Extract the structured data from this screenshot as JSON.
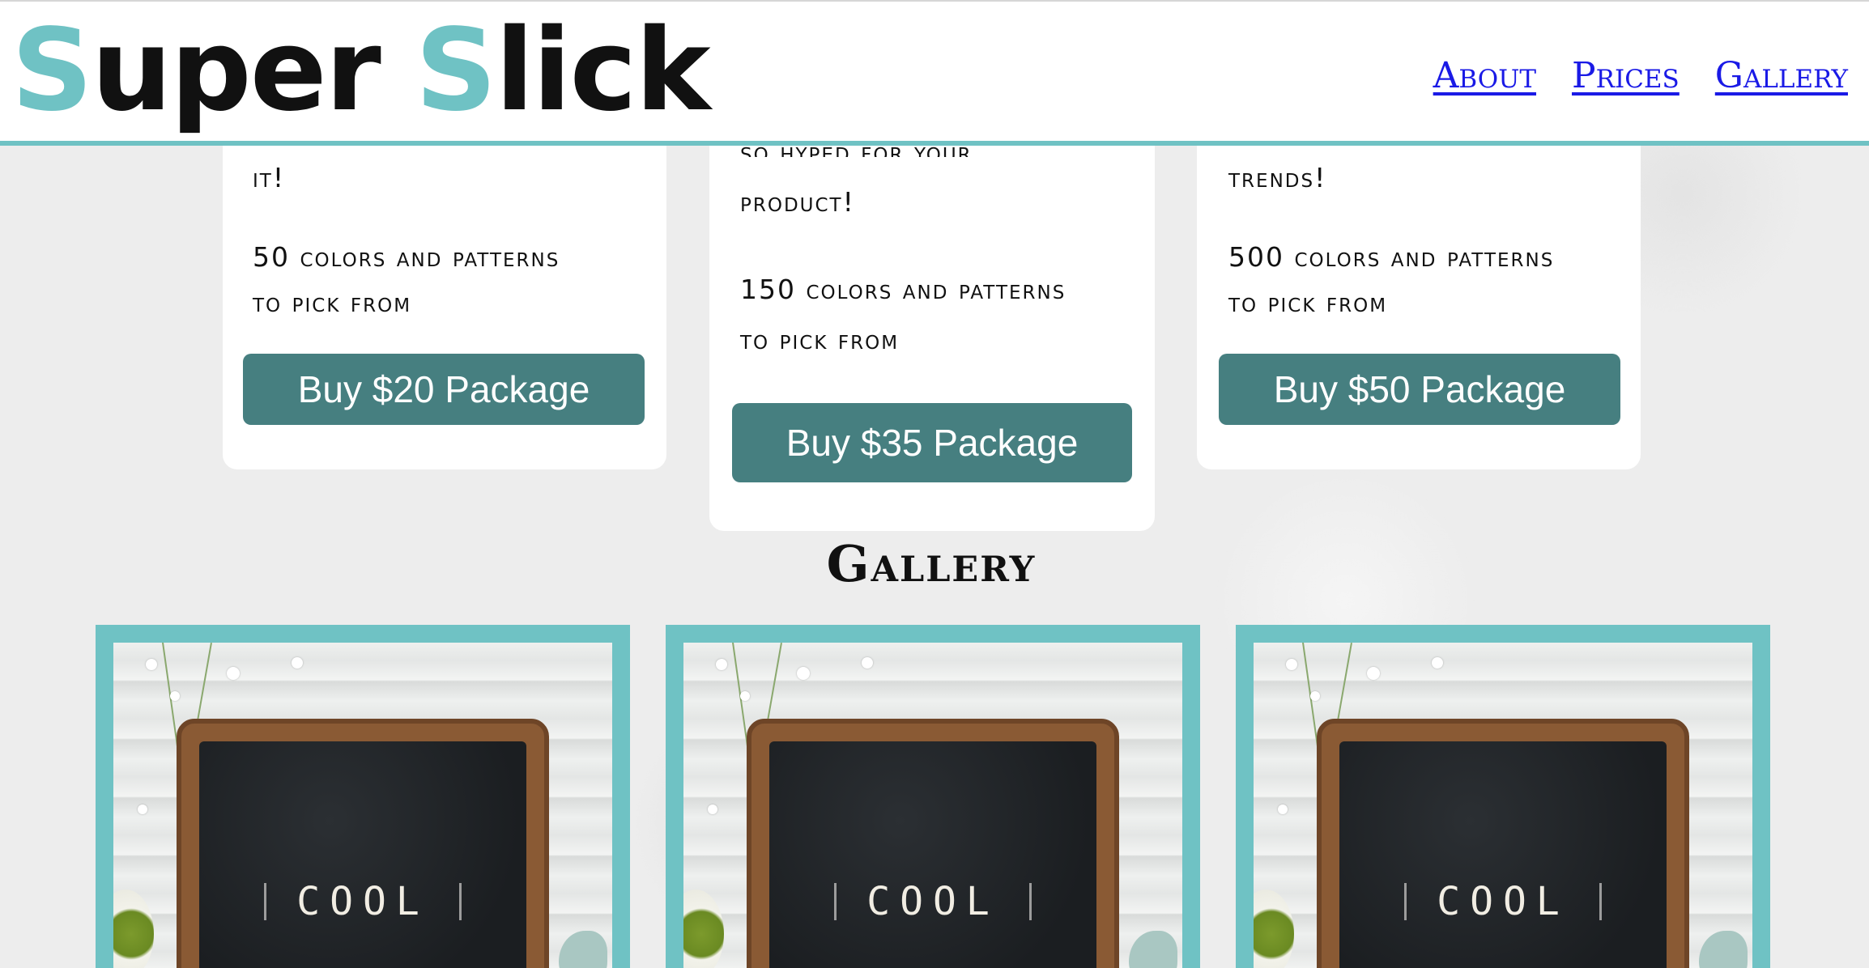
{
  "header": {
    "logo": {
      "first_initial": "S",
      "first_rest": "uper",
      "second_initial": "S",
      "second_rest": "lick"
    },
    "nav": [
      {
        "label": "About"
      },
      {
        "label": "Prices"
      },
      {
        "label": "Gallery"
      }
    ]
  },
  "pricing": {
    "cards": [
      {
        "top_text": "it!",
        "colors_line1": "50 colors and patterns",
        "colors_line2": "to pick from",
        "button_label": "Buy $20 Package"
      },
      {
        "top_text_line1": "so hyped for your",
        "top_text_line2": "product!",
        "colors_line1": "150 colors and patterns",
        "colors_line2": "to pick from",
        "button_label": "Buy $35 Package"
      },
      {
        "top_text": "trends!",
        "colors_line1": "500 colors and patterns",
        "colors_line2": "to pick from",
        "button_label": "Buy $50 Package"
      }
    ]
  },
  "gallery": {
    "title": "Gallery",
    "images": [
      {
        "board_text": "COOL"
      },
      {
        "board_text": "COOL"
      },
      {
        "board_text": "COOL"
      }
    ]
  },
  "colors": {
    "accent": "#6fc2c4",
    "button": "#467f80",
    "nav_link": "#1a1ae6",
    "card_background": "#ffffff",
    "page_background": "#ededed"
  }
}
